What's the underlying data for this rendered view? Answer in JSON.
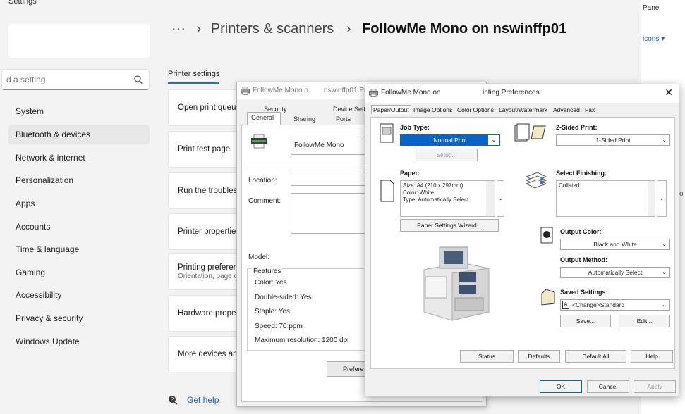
{
  "settings": {
    "app_title": "Settings",
    "search_placeholder": "d a setting",
    "nav": [
      {
        "label": "System"
      },
      {
        "label": "Bluetooth & devices"
      },
      {
        "label": "Network & internet"
      },
      {
        "label": "Personalization"
      },
      {
        "label": "Apps"
      },
      {
        "label": "Accounts"
      },
      {
        "label": "Time & language"
      },
      {
        "label": "Gaming"
      },
      {
        "label": "Accessibility"
      },
      {
        "label": "Privacy & security"
      },
      {
        "label": "Windows Update"
      }
    ],
    "breadcrumb": {
      "more": "···",
      "sep1": "›",
      "parent": "Printers & scanners",
      "sep2": "›",
      "current": "FollowMe Mono on nswinffp01"
    },
    "section_title": "Printer settings",
    "cards": [
      {
        "label": "Open print queu",
        "sub": ""
      },
      {
        "label": "Print test page",
        "sub": ""
      },
      {
        "label": "Run the troubles",
        "sub": ""
      },
      {
        "label": "Printer propertie",
        "sub": ""
      },
      {
        "label": "Printing preferer",
        "sub": "Orientation, page c"
      },
      {
        "label": "Hardware prope",
        "sub": ""
      },
      {
        "label": "More devices an",
        "sub": ""
      }
    ],
    "get_help": "Get help"
  },
  "right_panel": {
    "label": "Panel",
    "icons": "icons ▾",
    "o": "o"
  },
  "props": {
    "title": "FollowMe Mono o",
    "title_tail": "nswinffp01 Prope",
    "tabs_row1": {
      "security": "Security",
      "device": "Device Sett"
    },
    "tabs_row2": {
      "general": "General",
      "sharing": "Sharing",
      "ports": "Ports"
    },
    "printer_name": "FollowMe Mono",
    "location_label": "Location:",
    "comment_label": "Comment:",
    "model_label": "Model:",
    "features_label": "Features",
    "features": [
      "Color: Yes",
      "Double-sided: Yes",
      "Staple: Yes",
      "Speed: 70 ppm",
      "Maximum resolution: 1200 dpi"
    ],
    "prefs_button": "Prefere"
  },
  "prefs": {
    "title_left": "FollowMe Mono on",
    "title_right": "inting Preferences",
    "close": "✕",
    "tabs": [
      "Paper/Output",
      "Image Options",
      "Color Options",
      "Layout/Watermark",
      "Advanced",
      "Fax"
    ],
    "job_type": {
      "label": "Job Type:",
      "value": "Normal Print",
      "setup": "Setup..."
    },
    "paper": {
      "label": "Paper:",
      "lines": [
        "Size: A4 (210 x 297mm)",
        "Color: White",
        "Type: Automatically Select"
      ],
      "wizard": "Paper Settings Wizard..."
    },
    "two_sided": {
      "label": "2-Sided Print:",
      "value": "1-Sided Print"
    },
    "finishing": {
      "label": "Select Finishing:",
      "value": "Collated"
    },
    "output_color": {
      "label": "Output Color:",
      "value": "Black and White"
    },
    "output_method": {
      "label": "Output Method:",
      "value": "Automatically Select"
    },
    "saved_settings": {
      "label": "Saved Settings:",
      "value": "<Change>Standard",
      "save": "Save...",
      "edit": "Edit..."
    },
    "buttons": {
      "status": "Status",
      "defaults": "Defaults",
      "default_all": "Default All",
      "help": "Help"
    },
    "footer": {
      "ok": "OK",
      "cancel": "Cancel",
      "apply": "Apply"
    }
  },
  "colors": {
    "accent": "#0a64c8",
    "link": "#1a5fb4"
  }
}
